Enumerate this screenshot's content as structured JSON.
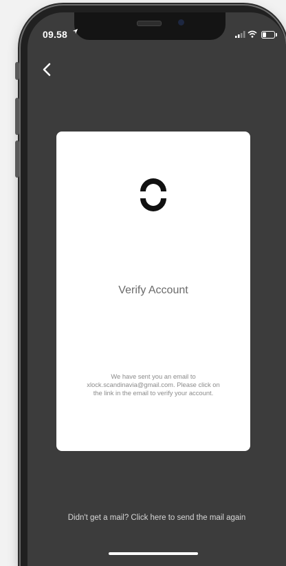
{
  "status_bar": {
    "time": "09.58",
    "location_icon": "location-arrow-icon",
    "signal_icon": "signal-bars-icon",
    "wifi_icon": "wifi-icon",
    "battery_icon": "battery-icon",
    "battery_level": 0.3
  },
  "navigation": {
    "back_icon": "chevron-left-icon"
  },
  "card": {
    "logo_icon": "brand-logo-icon",
    "title": "Verify Account",
    "message": "We have sent you an email to\nxlock.scandinavia@gmail.com. Please click on\nthe link in the email to verify your account."
  },
  "footer": {
    "resend_text": "Didn't get a mail? Click here to send the mail again"
  },
  "colors": {
    "screen_background": "#3c3c3c",
    "card_background": "#ffffff",
    "title_text": "#6a6a6a",
    "message_text": "#8a8a8a",
    "footer_text": "#d7d7d7",
    "logo": "#111111"
  }
}
